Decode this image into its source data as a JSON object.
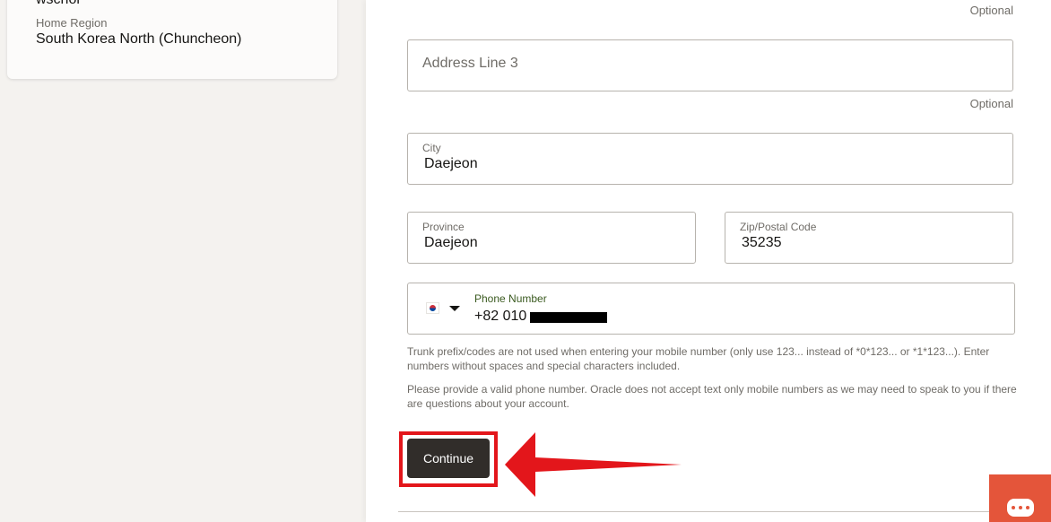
{
  "profile": {
    "username": "wschoi",
    "home_region_label": "Home Region",
    "home_region_value": "South Korea North (Chuncheon)"
  },
  "form": {
    "optional_label": "Optional",
    "address_line3": {
      "placeholder": "Address Line 3"
    },
    "city": {
      "label": "City",
      "value": "Daejeon"
    },
    "province": {
      "label": "Province",
      "value": "Daejeon"
    },
    "zip": {
      "label": "Zip/Postal Code",
      "value": "35235"
    },
    "phone": {
      "label": "Phone Number",
      "value": "+82 010",
      "country_flag_icon": "south-korea-flag-icon",
      "value_redacted": true
    },
    "help_text_1": "Trunk prefix/codes are not used when entering your mobile number (only use 123... instead of *0*123... or *1*123...). Enter numbers without spaces and special characters included.",
    "help_text_2": "Please provide a valid phone number. Oracle does not accept text only mobile numbers as we may need to speak to you if there are questions about your account.",
    "continue_label": "Continue"
  },
  "annotation": {
    "highlight_color": "#e3161b",
    "arrow_color": "#e3161b"
  },
  "chat": {
    "icon": "chat-icon",
    "color": "#e4553a"
  }
}
